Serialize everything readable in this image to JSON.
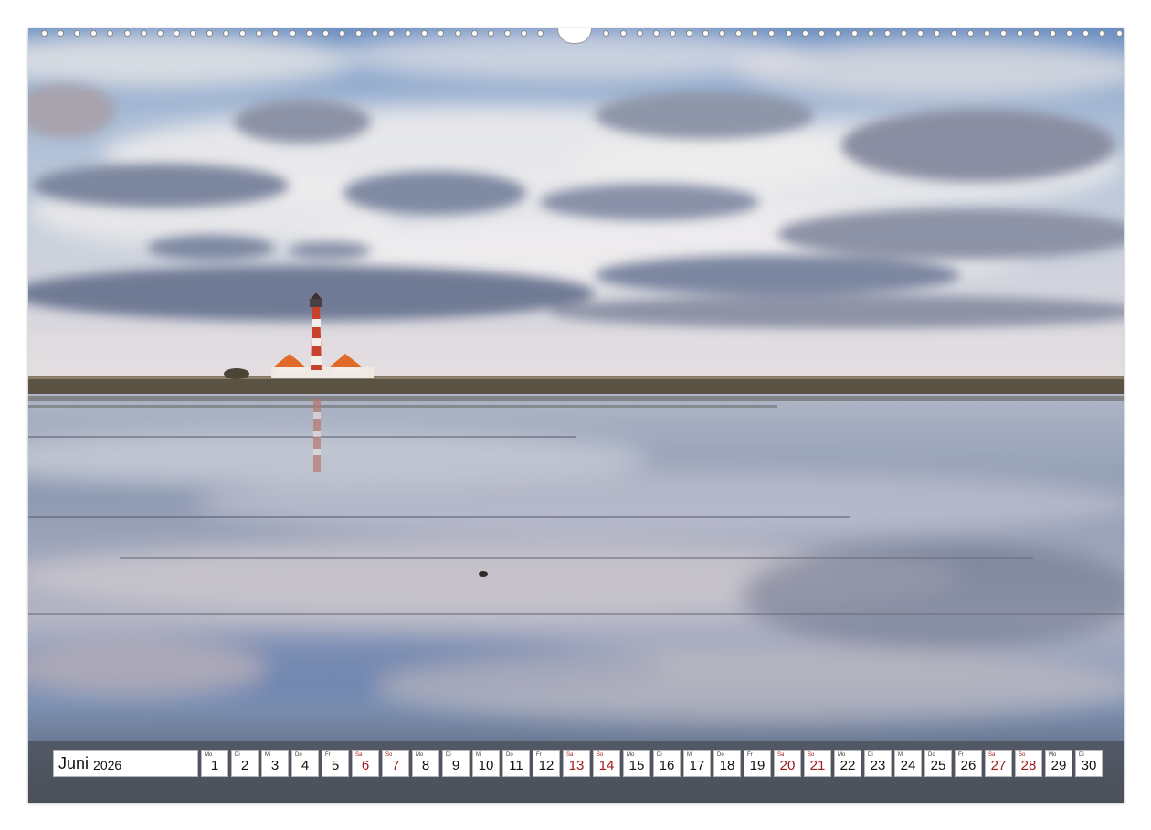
{
  "calendar": {
    "month": "Juni",
    "year": "2026",
    "days": [
      {
        "wd": "Mo",
        "num": "1",
        "weekend": false
      },
      {
        "wd": "Di",
        "num": "2",
        "weekend": false
      },
      {
        "wd": "Mi",
        "num": "3",
        "weekend": false
      },
      {
        "wd": "Do",
        "num": "4",
        "weekend": false
      },
      {
        "wd": "Fr",
        "num": "5",
        "weekend": false
      },
      {
        "wd": "Sa",
        "num": "6",
        "weekend": true
      },
      {
        "wd": "So",
        "num": "7",
        "weekend": true
      },
      {
        "wd": "Mo",
        "num": "8",
        "weekend": false
      },
      {
        "wd": "Di",
        "num": "9",
        "weekend": false
      },
      {
        "wd": "Mi",
        "num": "10",
        "weekend": false
      },
      {
        "wd": "Do",
        "num": "11",
        "weekend": false
      },
      {
        "wd": "Fr",
        "num": "12",
        "weekend": false
      },
      {
        "wd": "Sa",
        "num": "13",
        "weekend": true
      },
      {
        "wd": "So",
        "num": "14",
        "weekend": true
      },
      {
        "wd": "Mo",
        "num": "15",
        "weekend": false
      },
      {
        "wd": "Di",
        "num": "16",
        "weekend": false
      },
      {
        "wd": "Mi",
        "num": "17",
        "weekend": false
      },
      {
        "wd": "Do",
        "num": "18",
        "weekend": false
      },
      {
        "wd": "Fr",
        "num": "19",
        "weekend": false
      },
      {
        "wd": "Sa",
        "num": "20",
        "weekend": true
      },
      {
        "wd": "So",
        "num": "21",
        "weekend": true
      },
      {
        "wd": "Mo",
        "num": "22",
        "weekend": false
      },
      {
        "wd": "Di",
        "num": "23",
        "weekend": false
      },
      {
        "wd": "Mi",
        "num": "24",
        "weekend": false
      },
      {
        "wd": "Do",
        "num": "25",
        "weekend": false
      },
      {
        "wd": "Fr",
        "num": "26",
        "weekend": false
      },
      {
        "wd": "Sa",
        "num": "27",
        "weekend": true
      },
      {
        "wd": "So",
        "num": "28",
        "weekend": true
      },
      {
        "wd": "Mo",
        "num": "29",
        "weekend": false
      },
      {
        "wd": "Di",
        "num": "30",
        "weekend": false
      }
    ]
  },
  "colors": {
    "weekend": "#a01818",
    "sky_top": "#5f86bd",
    "lighthouse_red": "#c8412c",
    "roof_orange": "#e06a2a"
  },
  "photo": {
    "subject": "lighthouse-on-wadden-sea-mudflats"
  }
}
